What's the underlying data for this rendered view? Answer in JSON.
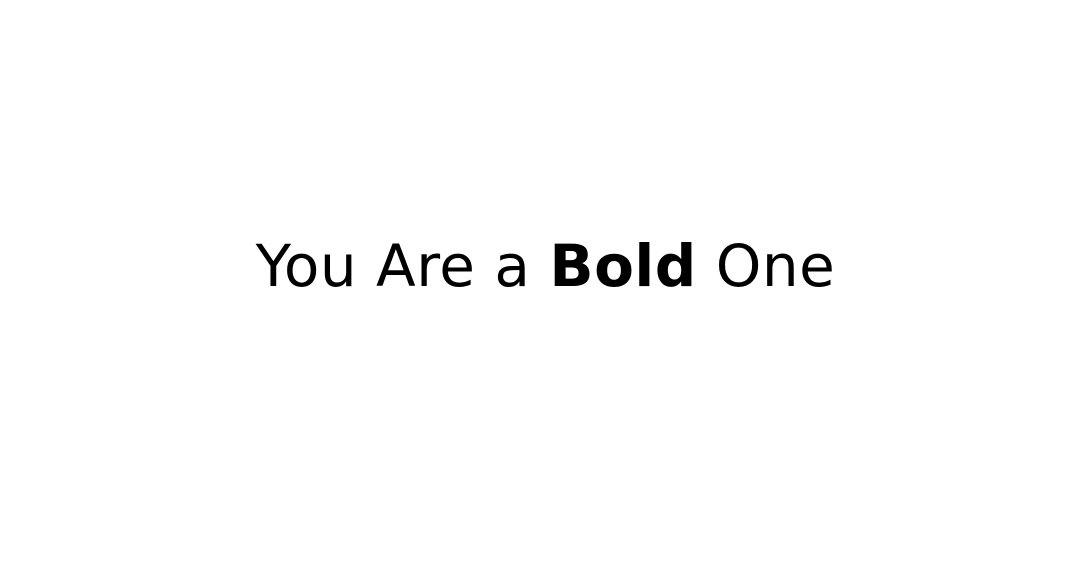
{
  "headline": {
    "before": "You Are a ",
    "emphasis": "Bold",
    "after": " One"
  },
  "colors": {
    "background": "#ffffff",
    "text": "#000000"
  }
}
